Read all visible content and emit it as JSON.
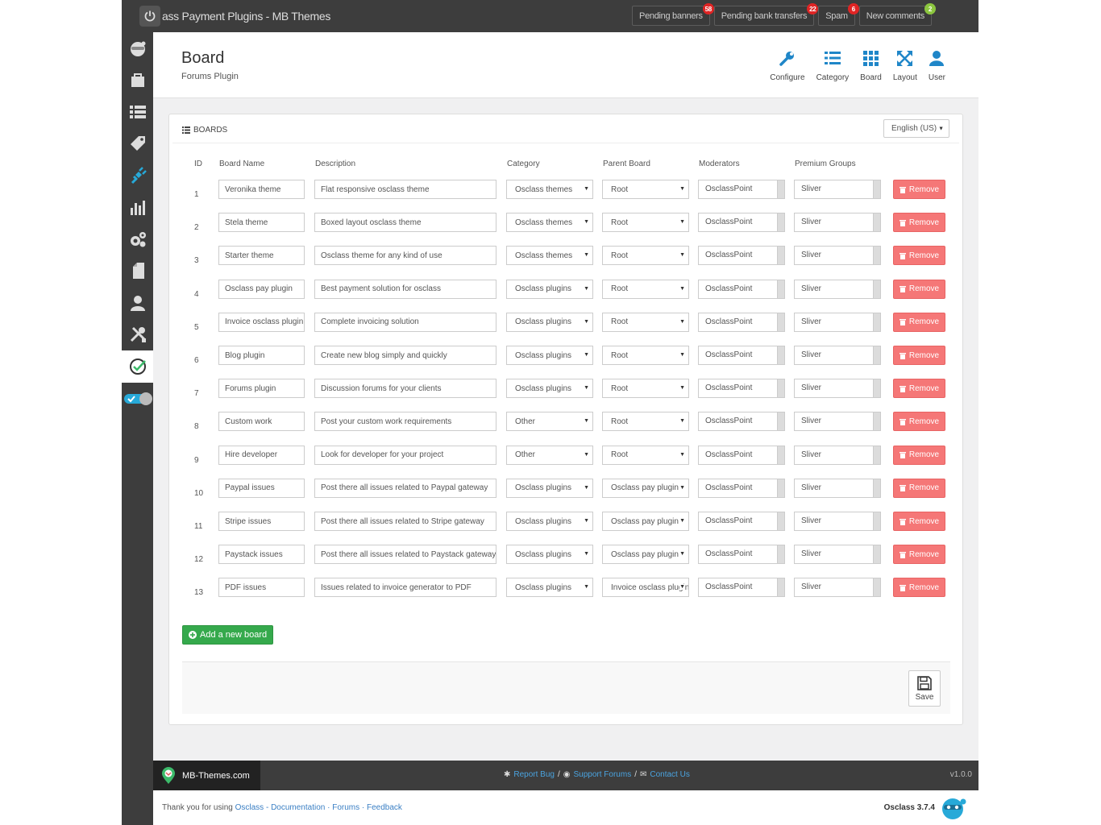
{
  "topbar": {
    "title": "ass Payment Plugins - MB Themes",
    "notifications": [
      {
        "label": "Pending banners",
        "count": "58",
        "color": "#e02424"
      },
      {
        "label": "Pending bank transfers",
        "count": "22",
        "color": "#e02424"
      },
      {
        "label": "Spam",
        "count": "6",
        "color": "#e02424"
      },
      {
        "label": "New comments",
        "count": "2",
        "color": "#8cc63f"
      }
    ]
  },
  "sidebar": {
    "icons": [
      "osclass-logo-icon",
      "bag-icon",
      "list-icon",
      "tag-icon",
      "plug-icon",
      "bar-chart-icon",
      "gears-icon",
      "page-icon",
      "user-icon",
      "tools-icon",
      "check-icon",
      "toggle-icon"
    ],
    "active_index": 4,
    "marked_index": 10
  },
  "header": {
    "title": "Board",
    "subtitle": "Forums Plugin",
    "nav": [
      {
        "label": "Configure",
        "icon": "wrench-icon"
      },
      {
        "label": "Category",
        "icon": "list-icon"
      },
      {
        "label": "Board",
        "icon": "grid-icon"
      },
      {
        "label": "Layout",
        "icon": "expand-icon"
      },
      {
        "label": "User",
        "icon": "user-icon"
      }
    ]
  },
  "panel": {
    "heading": "BOARDS",
    "language": "English (US)"
  },
  "table": {
    "columns": [
      "ID",
      "Board Name",
      "Description",
      "Category",
      "Parent Board",
      "Moderators",
      "Premium Groups"
    ],
    "remove_label": "Remove",
    "rows": [
      {
        "id": "1",
        "name": "Veronika theme",
        "desc": "Flat responsive osclass theme",
        "category": "Osclass themes",
        "parent": "Root",
        "mod": "OsclassPoint",
        "group": "Sliver"
      },
      {
        "id": "2",
        "name": "Stela theme",
        "desc": "Boxed layout osclass theme",
        "category": "Osclass themes",
        "parent": "Root",
        "mod": "OsclassPoint",
        "group": "Sliver"
      },
      {
        "id": "3",
        "name": "Starter theme",
        "desc": "Osclass theme for any kind of use",
        "category": "Osclass themes",
        "parent": "Root",
        "mod": "OsclassPoint",
        "group": "Sliver"
      },
      {
        "id": "4",
        "name": "Osclass pay plugin",
        "desc": "Best payment solution for osclass",
        "category": "Osclass plugins",
        "parent": "Root",
        "mod": "OsclassPoint",
        "group": "Sliver"
      },
      {
        "id": "5",
        "name": "Invoice osclass plugin",
        "desc": "Complete invoicing solution",
        "category": "Osclass plugins",
        "parent": "Root",
        "mod": "OsclassPoint",
        "group": "Sliver"
      },
      {
        "id": "6",
        "name": "Blog plugin",
        "desc": "Create new blog simply and quickly",
        "category": "Osclass plugins",
        "parent": "Root",
        "mod": "OsclassPoint",
        "group": "Sliver"
      },
      {
        "id": "7",
        "name": "Forums plugin",
        "desc": "Discussion forums for your clients",
        "category": "Osclass plugins",
        "parent": "Root",
        "mod": "OsclassPoint",
        "group": "Sliver"
      },
      {
        "id": "8",
        "name": "Custom work",
        "desc": "Post your custom work requirements",
        "category": "Other",
        "parent": "Root",
        "mod": "OsclassPoint",
        "group": "Sliver"
      },
      {
        "id": "9",
        "name": "Hire developer",
        "desc": "Look for developer for your project",
        "category": "Other",
        "parent": "Root",
        "mod": "OsclassPoint",
        "group": "Sliver"
      },
      {
        "id": "10",
        "name": "Paypal issues",
        "desc": "Post there all issues related to Paypal gateway",
        "category": "Osclass plugins",
        "parent": "Osclass pay plugin",
        "mod": "OsclassPoint",
        "group": "Sliver"
      },
      {
        "id": "11",
        "name": "Stripe issues",
        "desc": "Post there all issues related to Stripe gateway",
        "category": "Osclass plugins",
        "parent": "Osclass pay plugin",
        "mod": "OsclassPoint",
        "group": "Sliver"
      },
      {
        "id": "12",
        "name": "Paystack issues",
        "desc": "Post there all issues related to Paystack gateway",
        "category": "Osclass plugins",
        "parent": "Osclass pay plugin",
        "mod": "OsclassPoint",
        "group": "Sliver"
      },
      {
        "id": "13",
        "name": "PDF issues",
        "desc": "Issues related to invoice generator to PDF",
        "category": "Osclass plugins",
        "parent": "Invoice osclass plugin",
        "mod": "OsclassPoint",
        "group": "Sliver"
      }
    ]
  },
  "actions": {
    "add_label": "Add a new board",
    "save_label": "Save"
  },
  "footer": {
    "brand": "MB-Themes.com",
    "report": "Report Bug",
    "support": "Support Forums",
    "contact": "Contact Us",
    "version": "v1.0.0",
    "thanks_prefix": "Thank you for using",
    "thanks_osclass": "Osclass",
    "thanks_documentation": "Documentation",
    "thanks_forums": "Forums",
    "thanks_feedback": "Feedback",
    "osclass_version": "Osclass 3.7.4"
  }
}
